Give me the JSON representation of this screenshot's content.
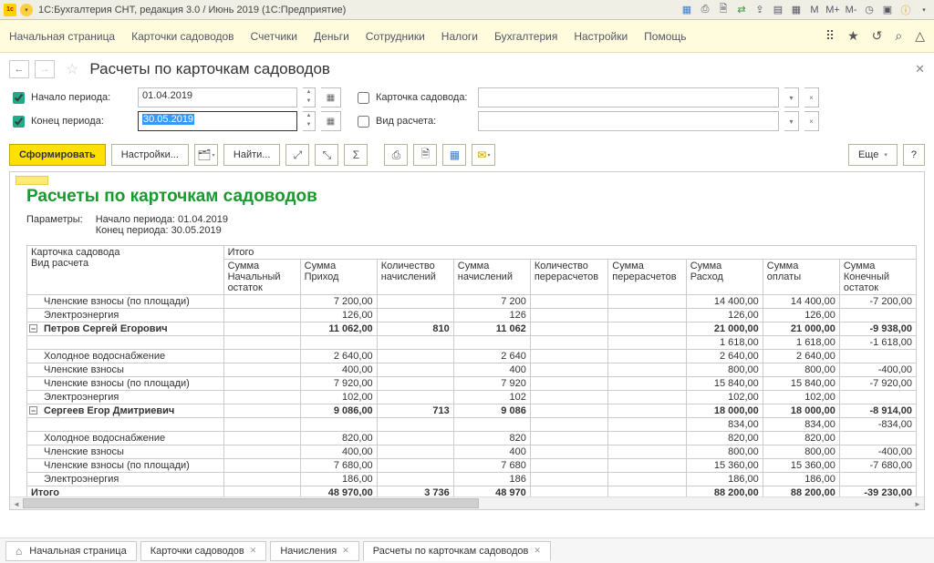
{
  "app": {
    "title": "1С:Бухгалтерия СНТ, редакция 3.0 / Июнь 2019  (1С:Предприятие)"
  },
  "menu": {
    "items": [
      "Начальная страница",
      "Карточки садоводов",
      "Счетчики",
      "Деньги",
      "Сотрудники",
      "Налоги",
      "Бухгалтерия",
      "Настройки",
      "Помощь"
    ]
  },
  "page": {
    "title": "Расчеты по карточкам садоводов"
  },
  "filters": {
    "start_label": "Начало периода:",
    "start_value": "01.04.2019",
    "end_label": "Конец периода:",
    "end_value": "30.05.2019",
    "card_label": "Карточка садовода:",
    "type_label": "Вид расчета:"
  },
  "toolbar": {
    "run": "Сформировать",
    "settings": "Настройки...",
    "find": "Найти...",
    "more": "Еще",
    "help": "?"
  },
  "report": {
    "title": "Расчеты по карточкам садоводов",
    "params_label": "Параметры:",
    "param1": "Начало периода: 01.04.2019",
    "param2": "Конец периода: 30.05.2019",
    "head_left1": "Карточка садовода",
    "head_left2": "Вид расчета",
    "head_total": "Итого",
    "cols": [
      "Сумма Начальный остаток",
      "Сумма Приход",
      "Количество начислений",
      "Сумма начислений",
      "Количество перерасчетов",
      "Сумма перерасчетов",
      "Сумма Расход",
      "Сумма оплаты",
      "Сумма Конечный остаток"
    ],
    "rows": [
      {
        "lvl": 2,
        "name": "Членские взносы (по площади)",
        "c": [
          "",
          "7 200,00",
          "",
          "7 200",
          "",
          "",
          "14 400,00",
          "14 400,00",
          "-7 200,00"
        ]
      },
      {
        "lvl": 2,
        "name": "Электроэнергия",
        "c": [
          "",
          "126,00",
          "",
          "126",
          "",
          "",
          "126,00",
          "126,00",
          ""
        ]
      },
      {
        "lvl": 1,
        "bold": true,
        "name": "Петров Сергей Егорович",
        "c": [
          "",
          "11 062,00",
          "810",
          "11 062",
          "",
          "",
          "21 000,00",
          "21 000,00",
          "-9 938,00"
        ]
      },
      {
        "lvl": 0,
        "name": "",
        "c": [
          "",
          "",
          "",
          "",
          "",
          "",
          "1 618,00",
          "1 618,00",
          "-1 618,00"
        ]
      },
      {
        "lvl": 2,
        "name": "Холодное водоснабжение",
        "c": [
          "",
          "2 640,00",
          "",
          "2 640",
          "",
          "",
          "2 640,00",
          "2 640,00",
          ""
        ]
      },
      {
        "lvl": 2,
        "name": "Членские взносы",
        "c": [
          "",
          "400,00",
          "",
          "400",
          "",
          "",
          "800,00",
          "800,00",
          "-400,00"
        ]
      },
      {
        "lvl": 2,
        "name": "Членские взносы (по площади)",
        "c": [
          "",
          "7 920,00",
          "",
          "7 920",
          "",
          "",
          "15 840,00",
          "15 840,00",
          "-7 920,00"
        ]
      },
      {
        "lvl": 2,
        "name": "Электроэнергия",
        "c": [
          "",
          "102,00",
          "",
          "102",
          "",
          "",
          "102,00",
          "102,00",
          ""
        ]
      },
      {
        "lvl": 1,
        "bold": true,
        "name": "Сергеев Егор Дмитриевич",
        "c": [
          "",
          "9 086,00",
          "713",
          "9 086",
          "",
          "",
          "18 000,00",
          "18 000,00",
          "-8 914,00"
        ]
      },
      {
        "lvl": 0,
        "name": "",
        "c": [
          "",
          "",
          "",
          "",
          "",
          "",
          "834,00",
          "834,00",
          "-834,00"
        ]
      },
      {
        "lvl": 2,
        "name": "Холодное водоснабжение",
        "c": [
          "",
          "820,00",
          "",
          "820",
          "",
          "",
          "820,00",
          "820,00",
          ""
        ]
      },
      {
        "lvl": 2,
        "name": "Членские взносы",
        "c": [
          "",
          "400,00",
          "",
          "400",
          "",
          "",
          "800,00",
          "800,00",
          "-400,00"
        ]
      },
      {
        "lvl": 2,
        "name": "Членские взносы (по площади)",
        "c": [
          "",
          "7 680,00",
          "",
          "7 680",
          "",
          "",
          "15 360,00",
          "15 360,00",
          "-7 680,00"
        ]
      },
      {
        "lvl": 2,
        "name": "Электроэнергия",
        "c": [
          "",
          "186,00",
          "",
          "186",
          "",
          "",
          "186,00",
          "186,00",
          ""
        ]
      }
    ],
    "total_label": "Итого",
    "total": [
      "",
      "48 970,00",
      "3 736",
      "48 970",
      "",
      "",
      "88 200,00",
      "88 200,00",
      "-39 230,00"
    ]
  },
  "tabs": {
    "items": [
      {
        "label": "Начальная страница",
        "home": true
      },
      {
        "label": "Карточки садоводов",
        "close": true
      },
      {
        "label": "Начисления",
        "close": true
      },
      {
        "label": "Расчеты по карточкам садоводов",
        "close": true,
        "active": true
      }
    ]
  }
}
